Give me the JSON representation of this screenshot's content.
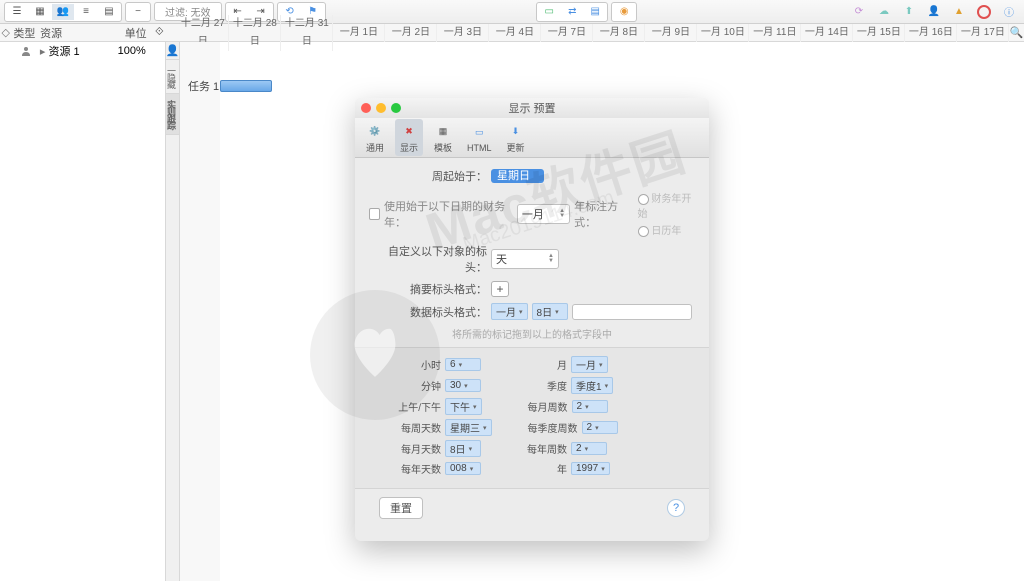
{
  "toolbar": {
    "filter_label": "过滤: 无效"
  },
  "columns": {
    "type": "类型",
    "resource": "资源",
    "unit": "单位",
    "util": "⟐"
  },
  "resource_row": {
    "name": "资源 1",
    "unit": "100%"
  },
  "side_tabs": {
    "hidden": "一隐藏",
    "actual": "实则跟踪"
  },
  "gantt": {
    "task_label": "任务 1",
    "dates": [
      "十二月 27日",
      "十二月 28日",
      "十二月 31日",
      "一月 1日",
      "一月 2日",
      "一月 3日",
      "一月 4日",
      "一月 7日",
      "一月 8日",
      "一月 9日",
      "一月 10日",
      "一月 11日",
      "一月 14日",
      "一月 15日",
      "一月 16日",
      "一月 17日"
    ]
  },
  "modal": {
    "title": "显示 预置",
    "tabs": {
      "general": "通用",
      "display": "显示",
      "templates": "模板",
      "html": "HTML",
      "update": "更新"
    },
    "week_start_label": "周起始于：",
    "week_start_value": "星期日",
    "fiscal_checkbox_label": "使用始于以下日期的财务年：",
    "fiscal_month": "一月",
    "year_label_mode_label": "年标注方式：",
    "year_mode_fiscal": "财务年开始",
    "year_mode_calendar": "日历年",
    "custom_scale_label": "自定义以下对象的标头：",
    "custom_scale_value": "天",
    "summary_format_label": "摘要标头格式：",
    "data_format_label": "数据标头格式：",
    "data_format_month": "一月",
    "data_format_day": "8日",
    "hint": "将所需的标记拖到以上的格式字段中",
    "grid": {
      "hour_label": "小时",
      "hour_val": "6",
      "minute_label": "分钟",
      "minute_val": "30",
      "ampm_label": "上午/下午",
      "ampm_val": "下午",
      "weekday_label": "每周天数",
      "weekday_val": "星期三",
      "monthday_label": "每月天数",
      "monthday_val": "8日",
      "yearday_label": "每年天数",
      "yearday_val": "008",
      "month_label": "月",
      "month_val": "一月",
      "quarter_label": "季度",
      "quarter_val": "季度1",
      "monthweek_label": "每月周数",
      "monthweek_val": "2",
      "quarterweek_label": "每季度周数",
      "quarterweek_val": "2",
      "yearweek_label": "每年周数",
      "yearweek_val": "2",
      "year_label": "年",
      "year_val": "1997"
    },
    "reset": "重置"
  }
}
